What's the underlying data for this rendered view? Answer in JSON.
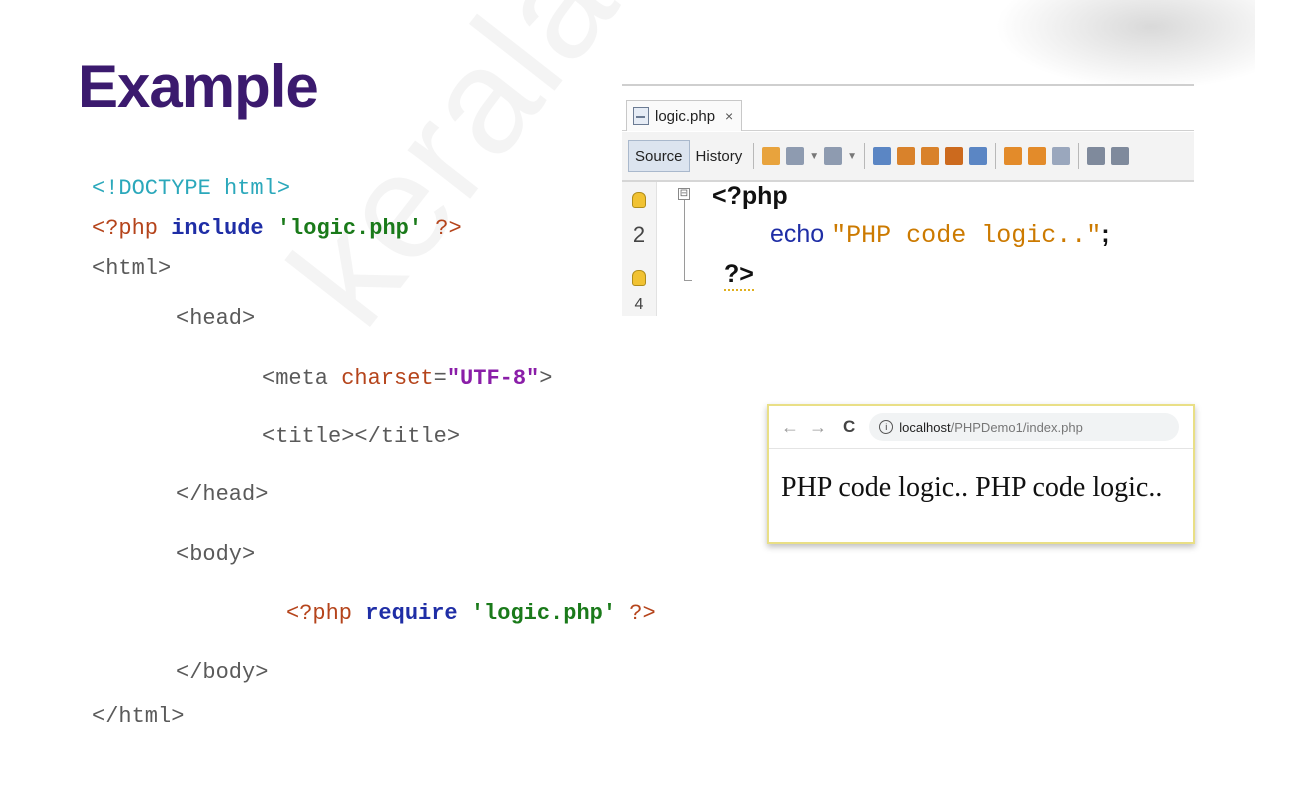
{
  "slide": {
    "title": "Example",
    "watermark": "keralai"
  },
  "code": {
    "doctype": "<!DOCTYPE html>",
    "line2": {
      "open": "<?php",
      "kw": "include",
      "str": "'logic.php'",
      "close": "?>"
    },
    "html_open": "<html>",
    "head_open": "<head>",
    "meta": {
      "open": "<meta",
      "attr": "charset",
      "eq": "=",
      "val": "\"UTF-8\"",
      "close": ">"
    },
    "title_tag": "<title></title>",
    "head_close": "</head>",
    "body_open": "<body>",
    "require_line": {
      "open": "<?php",
      "kw": "require",
      "str": "'logic.php'",
      "close": "?>"
    },
    "body_close": "</body>",
    "html_close": "</html>"
  },
  "ide": {
    "file_tab": "logic.php",
    "close": "×",
    "source_tab": "Source",
    "history_tab": "History",
    "line_number": "2",
    "line4": "4",
    "php_open": "<?php",
    "echo": "echo",
    "echo_string": "\"PHP code logic..\"",
    "semicolon": ";",
    "php_close": "?>",
    "fold_symbol": "⊟"
  },
  "browser": {
    "back": "←",
    "forward": "→",
    "reload": "C",
    "info": "i",
    "url_host": "localhost",
    "url_path": "/PHPDemo1/index.php",
    "output": "PHP code logic.. PHP code logic.."
  },
  "colors": {
    "title": "#3b1a6e",
    "keyword": "#1f2ea6",
    "string": "#1a7a1a",
    "doctype": "#2ba8bb",
    "echo_string": "#cc7a00"
  }
}
